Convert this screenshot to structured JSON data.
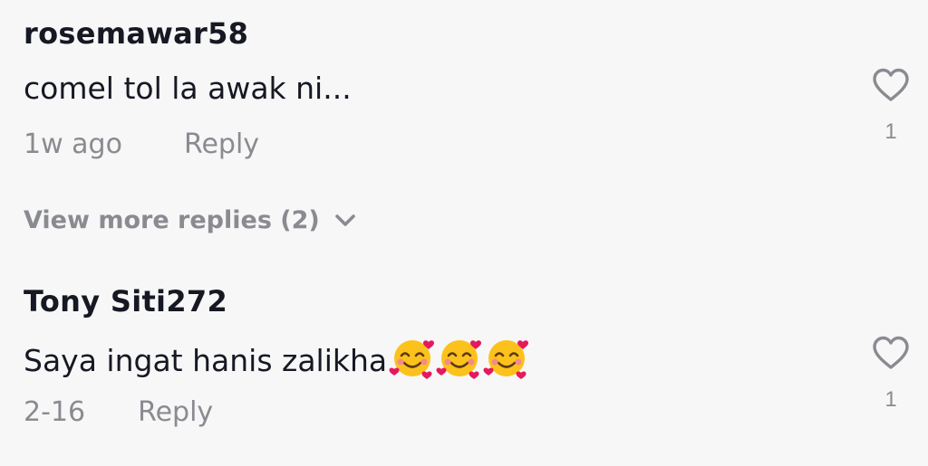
{
  "comments": [
    {
      "username": "rosemawar58",
      "text": "comel tol la awak ni...",
      "time": "1w ago",
      "reply_label": "Reply",
      "like_count": "1",
      "emojis": []
    },
    {
      "username": "Tony Siti272",
      "text": "Saya ingat hanis zalikha",
      "time": "2-16",
      "reply_label": "Reply",
      "like_count": "1",
      "emojis": [
        "smiling-face-with-hearts",
        "smiling-face-with-hearts",
        "smiling-face-with-hearts"
      ]
    }
  ],
  "view_more": {
    "label": "View more replies (2)",
    "icon": "chevron-down-icon"
  },
  "icons": {
    "like": "heart-outline-icon"
  },
  "colors": {
    "background": "#f7f7f7",
    "primary_text": "#161823",
    "secondary_text": "#8a8b91"
  }
}
